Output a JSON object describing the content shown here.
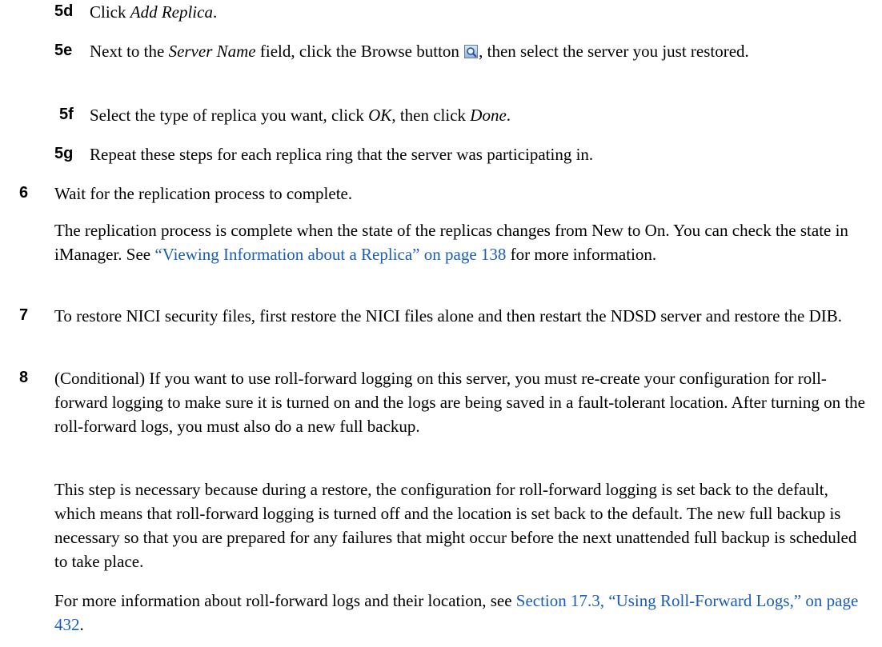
{
  "steps": {
    "s5d": {
      "num": "5d",
      "pre": "Click ",
      "em": "Add Replica",
      "post": "."
    },
    "s5e": {
      "num": "5e",
      "pre": "Next to the ",
      "em": "Server Name",
      "mid": " field, click the Browse button ",
      "icon": "magnifier-browse-icon",
      "post": ", then select the server you just restored."
    },
    "s5f": {
      "num": "5f",
      "pre": "Select the type of replica you want, click ",
      "em1": "OK",
      "mid": ", then click ",
      "em2": "Done",
      "post": "."
    },
    "s5g": {
      "num": "5g",
      "text": "Repeat these steps for each replica ring that the server was participating in."
    },
    "s6": {
      "num": "6",
      "text": "Wait for the replication process to complete.",
      "para_pre": "The replication process is complete when the state of the replicas changes from New to On. You can check the state in iManager. See ",
      "link": "“Viewing Information about a Replica” on page 138",
      "para_post": " for more information."
    },
    "s7": {
      "num": "7",
      "text": "To restore NICI security files, first restore the NICI files alone and then restart the NDSD server and restore the DIB."
    },
    "s8": {
      "num": "8",
      "text": "(Conditional) If you want to use roll-forward logging on this server, you must re-create your configuration for roll-forward logging to make sure it is turned on and the logs are being saved in a fault-tolerant location. After turning on the roll-forward logs, you must also do a new full backup.",
      "para1": "This step is necessary because during a restore, the configuration for roll-forward logging is set back to the default, which means that roll-forward logging is turned off and the location is set back to the default. The new full backup is necessary so that you are prepared for any failures that might occur before the next unattended full backup is scheduled to take place.",
      "para2_pre": "For more information about roll-forward logs and their location, see ",
      "link": "Section 17.3, “Using Roll-Forward Logs,” on page 432",
      "para2_post": "."
    }
  }
}
